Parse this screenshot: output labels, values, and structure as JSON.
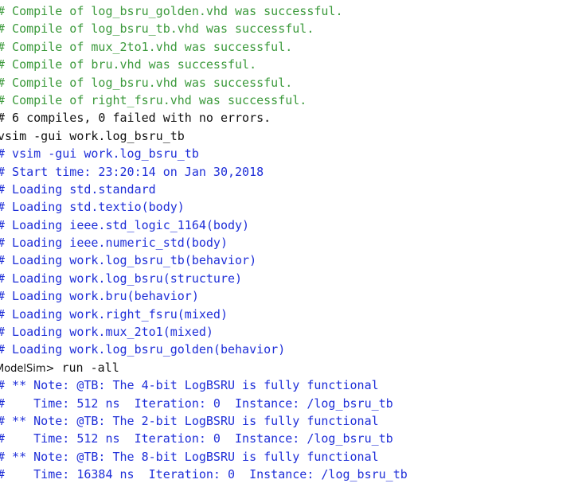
{
  "transcript": {
    "compile_lines": [
      "# Compile of log_bsru_golden.vhd was successful.",
      "# Compile of log_bsru_tb.vhd was successful.",
      "# Compile of mux_2to1.vhd was successful.",
      "# Compile of bru.vhd was successful.",
      "# Compile of log_bsru.vhd was successful.",
      "# Compile of right_fsru.vhd was successful."
    ],
    "summary": "# 6 compiles, 0 failed with no errors.",
    "command_vsim": "vsim -gui work.log_bsru_tb",
    "vsim_output": [
      "# vsim -gui work.log_bsru_tb",
      "# Start time: 23:20:14 on Jan 30,2018",
      "# Loading std.standard",
      "# Loading std.textio(body)",
      "# Loading ieee.std_logic_1164(body)",
      "# Loading ieee.numeric_std(body)",
      "# Loading work.log_bsru_tb(behavior)",
      "# Loading work.log_bsru(structure)",
      "# Loading work.bru(behavior)",
      "# Loading work.right_fsru(mixed)",
      "# Loading work.mux_2to1(mixed)",
      "# Loading work.log_bsru_golden(behavior)"
    ],
    "prompt_label": "ModelSim>",
    "prompt_command": " run -all",
    "run_output": [
      "# ** Note: @TB: The 4-bit LogBSRU is fully functional",
      "#    Time: 512 ns  Iteration: 0  Instance: /log_bsru_tb",
      "# ** Note: @TB: The 2-bit LogBSRU is fully functional",
      "#    Time: 512 ns  Iteration: 0  Instance: /log_bsru_tb",
      "# ** Note: @TB: The 8-bit LogBSRU is fully functional",
      "#    Time: 16384 ns  Iteration: 0  Instance: /log_bsru_tb"
    ]
  },
  "colors": {
    "compile_text": "#3c9a3c",
    "command_text": "#111111",
    "output_text": "#1f2fd8",
    "background": "#ffffff"
  }
}
